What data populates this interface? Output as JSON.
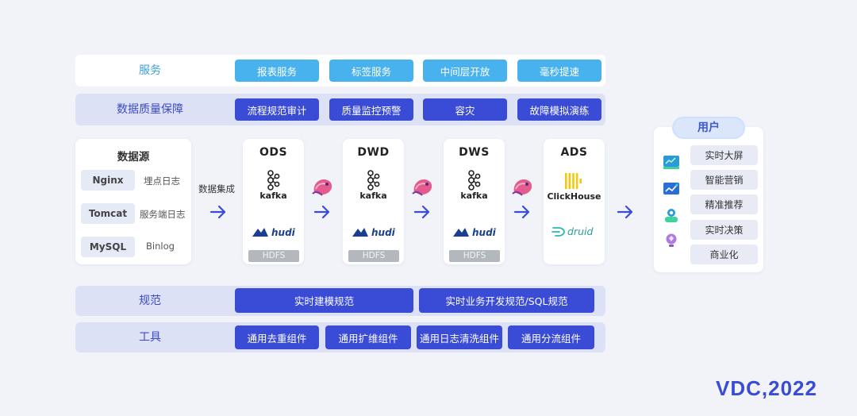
{
  "rows": {
    "service": {
      "label": "服务",
      "items": [
        "报表服务",
        "标签服务",
        "中间层开放",
        "毫秒提速"
      ]
    },
    "quality": {
      "label": "数据质量保障",
      "items": [
        "流程规范审计",
        "质量监控预警",
        "容灾",
        "故障模拟演练"
      ]
    },
    "spec": {
      "label": "规范",
      "items": [
        "实时建模规范",
        "实时业务开发规范/SQL规范"
      ]
    },
    "tools": {
      "label": "工具",
      "items": [
        "通用去重组件",
        "通用扩维组件",
        "通用日志清洗组件",
        "通用分流组件"
      ]
    }
  },
  "source": {
    "title": "数据源",
    "entries": [
      {
        "tag": "Nginx",
        "desc": "埋点日志"
      },
      {
        "tag": "Tomcat",
        "desc": "服务端日志"
      },
      {
        "tag": "MySQL",
        "desc": "Binlog"
      }
    ]
  },
  "integration_label": "数据集成",
  "layers": [
    {
      "title": "ODS",
      "mq": "kafka",
      "lake": "hudi",
      "storage": "HDFS"
    },
    {
      "title": "DWD",
      "mq": "kafka",
      "lake": "hudi",
      "storage": "HDFS"
    },
    {
      "title": "DWS",
      "mq": "kafka",
      "lake": "hudi",
      "storage": "HDFS"
    },
    {
      "title": "ADS",
      "engine1": "ClickHouse",
      "engine2": "druid"
    }
  ],
  "users": {
    "title": "用户",
    "items": [
      "实时大屏",
      "智能营销",
      "精准推荐",
      "实时决策",
      "商业化"
    ]
  },
  "logo": "VDC,2022",
  "icons": [
    "kafka-icon",
    "hudi-icon",
    "flink-squirrel-icon",
    "clickhouse-icon",
    "druid-icon",
    "arrow-right-icon",
    "dashboard-icon",
    "chart-icon",
    "person-icon",
    "bulb-icon"
  ],
  "colors": {
    "accent_dark": "#3a4bd6",
    "accent_light": "#48b2ee",
    "label_blue": "#3ea0dc",
    "label_indigo": "#3c4bc2"
  }
}
